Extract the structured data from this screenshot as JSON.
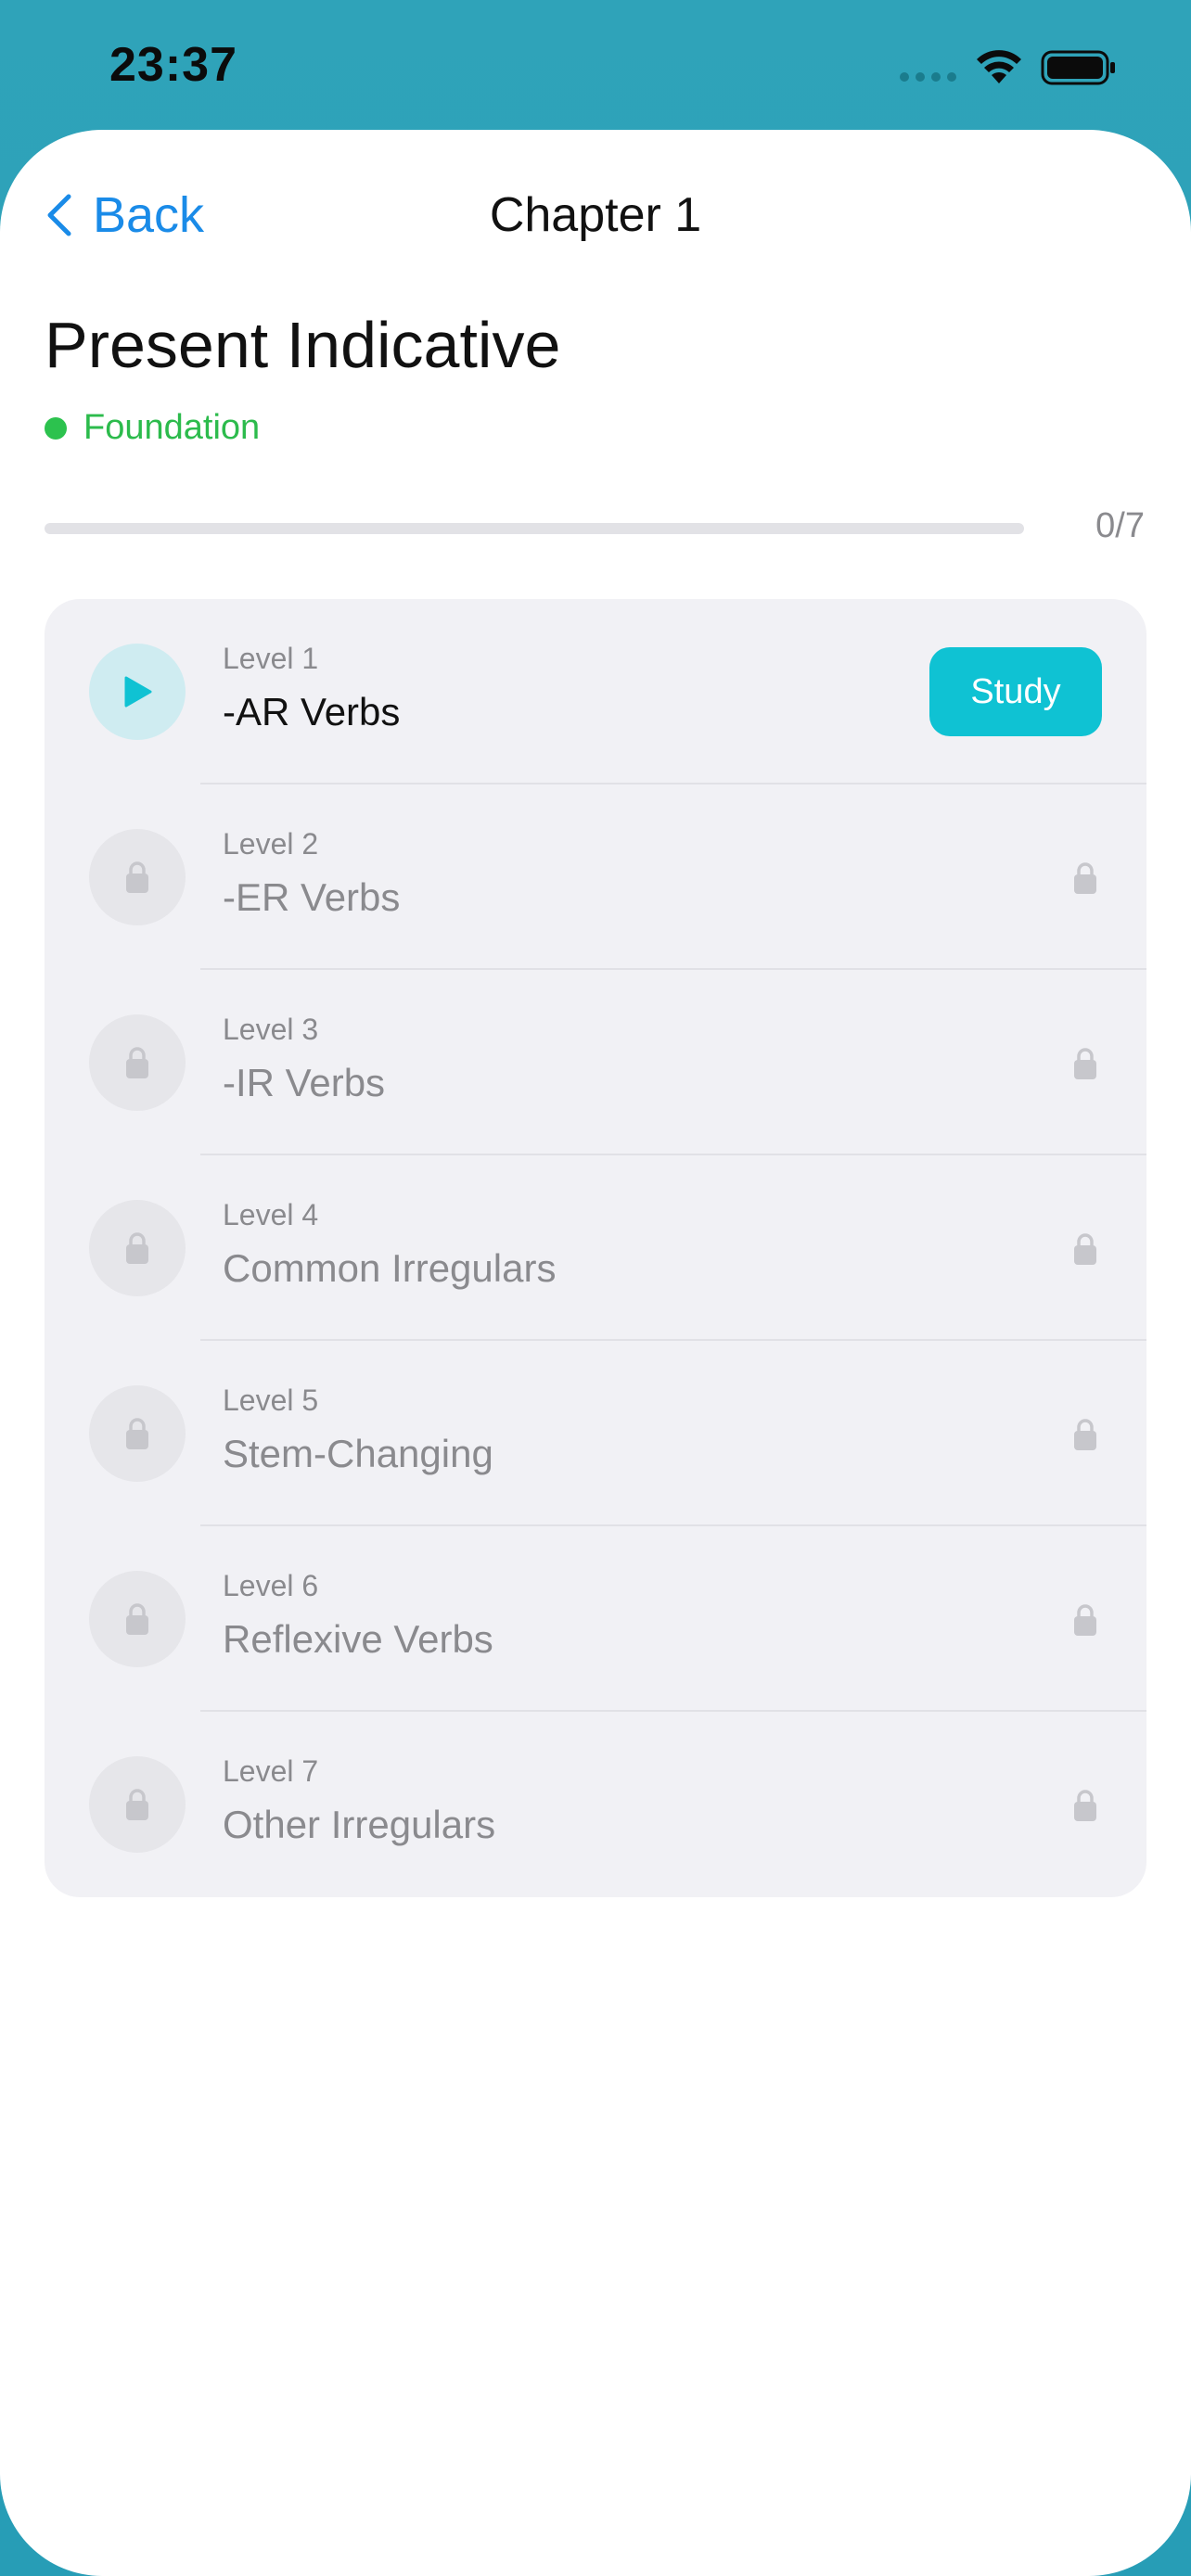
{
  "status": {
    "time": "23:37"
  },
  "nav": {
    "back_label": "Back",
    "title": "Chapter 1"
  },
  "page": {
    "title": "Present Indicative",
    "tier": "Foundation",
    "tier_color": "#2cbb4c"
  },
  "progress": {
    "completed": 0,
    "total": 7,
    "text": "0/7"
  },
  "accent_color": "#0fc2d3",
  "levels": [
    {
      "caption": "Level 1",
      "name": "-AR Verbs",
      "state": "unlocked",
      "icon": "play-icon",
      "action": "Study"
    },
    {
      "caption": "Level 2",
      "name": "-ER Verbs",
      "state": "locked",
      "icon": "lock-icon"
    },
    {
      "caption": "Level 3",
      "name": "-IR Verbs",
      "state": "locked",
      "icon": "lock-icon"
    },
    {
      "caption": "Level 4",
      "name": "Common Irregulars",
      "state": "locked",
      "icon": "lock-icon"
    },
    {
      "caption": "Level 5",
      "name": "Stem-Changing",
      "state": "locked",
      "icon": "lock-icon"
    },
    {
      "caption": "Level 6",
      "name": "Reflexive Verbs",
      "state": "locked",
      "icon": "lock-icon"
    },
    {
      "caption": "Level 7",
      "name": "Other Irregulars",
      "state": "locked",
      "icon": "lock-icon"
    }
  ]
}
